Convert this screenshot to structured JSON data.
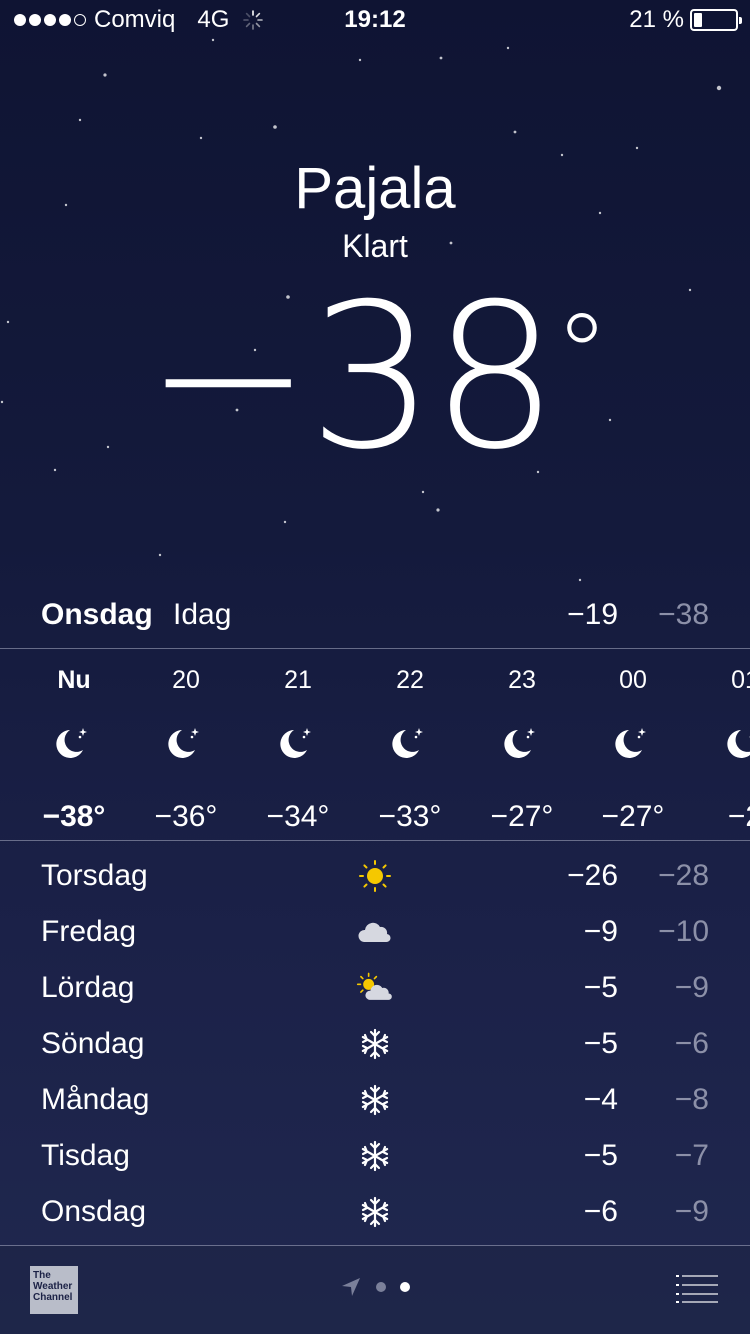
{
  "status": {
    "carrier": "Comviq",
    "network": "4G",
    "time": "19:12",
    "battery_pct": "21 %",
    "battery_level": 0.21,
    "signal_bars_filled": 4,
    "signal_bars_total": 5
  },
  "location": {
    "city": "Pajala",
    "condition": "Klart",
    "temperature": "−38",
    "degree_symbol": "°"
  },
  "today": {
    "day": "Onsdag",
    "label": "Idag",
    "high": "−19",
    "low": "−38"
  },
  "hourly": [
    {
      "time": "Nu",
      "icon": "moon-stars-icon",
      "temp": "−38°"
    },
    {
      "time": "20",
      "icon": "moon-stars-icon",
      "temp": "−36°"
    },
    {
      "time": "21",
      "icon": "moon-stars-icon",
      "temp": "−34°"
    },
    {
      "time": "22",
      "icon": "moon-stars-icon",
      "temp": "−33°"
    },
    {
      "time": "23",
      "icon": "moon-stars-icon",
      "temp": "−27°"
    },
    {
      "time": "00",
      "icon": "moon-stars-icon",
      "temp": "−27°"
    },
    {
      "time": "01",
      "icon": "moon-stars-icon",
      "temp": "−2"
    }
  ],
  "daily": [
    {
      "day": "Torsdag",
      "icon": "sun-icon",
      "high": "−26",
      "low": "−28"
    },
    {
      "day": "Fredag",
      "icon": "cloud-icon",
      "high": "−9",
      "low": "−10"
    },
    {
      "day": "Lördag",
      "icon": "partly-cloudy-icon",
      "high": "−5",
      "low": "−9"
    },
    {
      "day": "Söndag",
      "icon": "snowflake-icon",
      "high": "−5",
      "low": "−6"
    },
    {
      "day": "Måndag",
      "icon": "snowflake-icon",
      "high": "−4",
      "low": "−8"
    },
    {
      "day": "Tisdag",
      "icon": "snowflake-icon",
      "high": "−5",
      "low": "−7"
    },
    {
      "day": "Onsdag",
      "icon": "snowflake-icon",
      "high": "−6",
      "low": "−9"
    }
  ],
  "footer": {
    "logo_text": "The Weather Channel",
    "page_count": 2,
    "active_page": 2
  },
  "colors": {
    "background_top": "#0f1433",
    "background_bottom": "#20284f",
    "sun": "#f5c800",
    "low_temp": "#8c90a8"
  }
}
